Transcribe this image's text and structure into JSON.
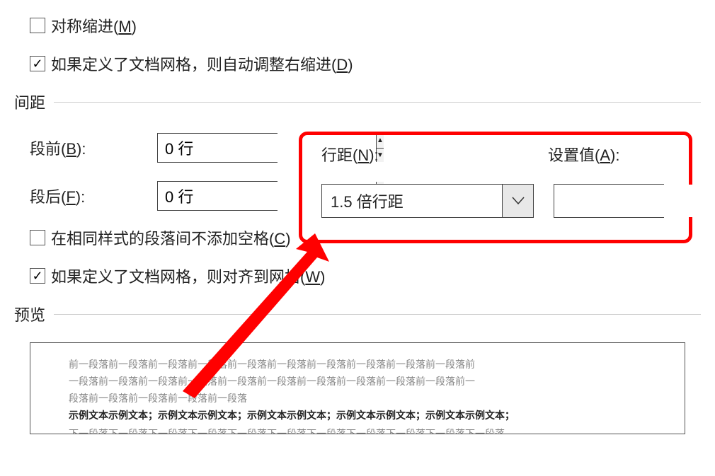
{
  "checkboxes": {
    "mirror_indent": {
      "label_pre": "对称缩进(",
      "mnemonic": "M",
      "label_post": ")",
      "checked": false
    },
    "auto_right_indent": {
      "label_pre": "如果定义了文档网格，则自动调整右缩进(",
      "mnemonic": "D",
      "label_post": ")",
      "checked": true
    },
    "no_space_same_style": {
      "label_pre": "在相同样式的段落间不添加空格(",
      "mnemonic": "C",
      "label_post": ")",
      "checked": false
    },
    "snap_to_grid": {
      "label_pre": "如果定义了文档网格，则对齐到网格(",
      "mnemonic": "W",
      "label_post": ")",
      "checked": true
    }
  },
  "sections": {
    "spacing": "间距",
    "preview": "预览"
  },
  "spacing": {
    "before_label_pre": "段前(",
    "before_m": "B",
    "before_label_post": "):",
    "after_label_pre": "段后(",
    "after_m": "F",
    "after_label_post": "):",
    "before_value": "0 行",
    "after_value": "0 行",
    "line_spacing_label_pre": "行距(",
    "line_spacing_m": "N",
    "line_spacing_label_post": "):",
    "set_value_label_pre": "设置值(",
    "set_value_m": "A",
    "set_value_label_post": "):",
    "line_spacing_value": "1.5 倍行距",
    "set_value": ""
  },
  "preview": {
    "line1": "前一段落前一段落前一段落前一段落前一段落前一段落前一段落前一段落前一段落前一段落前",
    "line2": "一段落前一段落前一段落前一段落前一段落前一段落前一段落前一段落前一段落前一段落前一",
    "line3": "段落前一段落前一段落前一段落前一段落",
    "sample": "示例文本示例文本；示例文本示例文本；示例文本示例文本；示例文本示例文本；示例文本示例文本；",
    "line5": "下一段落下一段落下一段落下一段落下一段落下一段落下一段落下一段落下一段落下一段落下一段落"
  }
}
